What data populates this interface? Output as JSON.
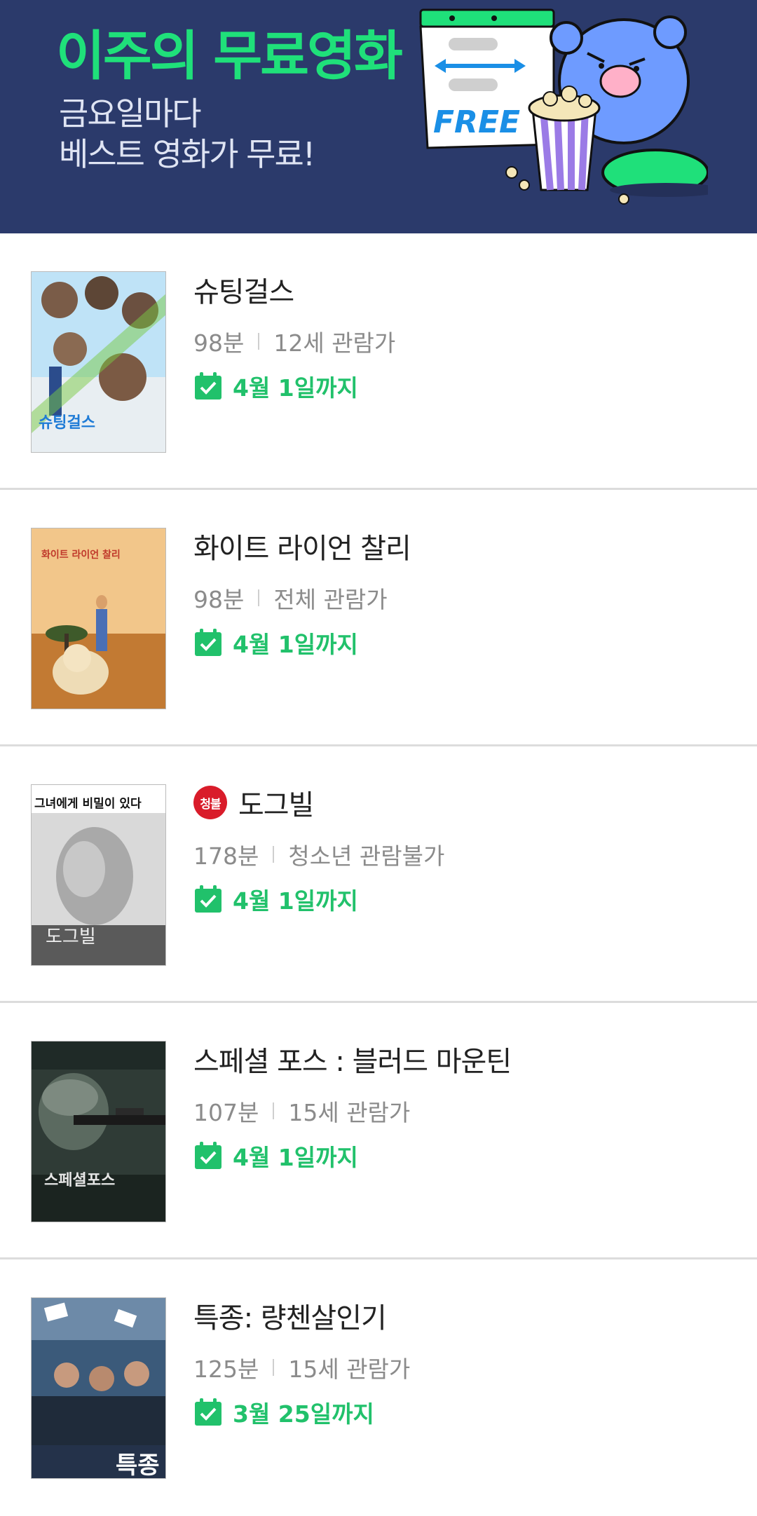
{
  "banner": {
    "title": "이주의 무료영화",
    "subtitle_line1": "금요일마다",
    "subtitle_line2": "베스트 영화가 무료!",
    "free_label": "FREE"
  },
  "colors": {
    "banner_bg": "#2b3a6b",
    "accent_green": "#21c16b",
    "badge_red": "#d91c2a"
  },
  "movies": [
    {
      "title": "슈팅걸스",
      "runtime": "98분",
      "age_rating": "12세 관람가",
      "free_until": "4월 1일까지",
      "poster_caption": "슈팅걸스",
      "badge": ""
    },
    {
      "title": "화이트 라이언 찰리",
      "runtime": "98분",
      "age_rating": "전체 관람가",
      "free_until": "4월 1일까지",
      "poster_caption": "화이트 라이언 찰리",
      "badge": ""
    },
    {
      "title": "도그빌",
      "runtime": "178분",
      "age_rating": "청소년 관람불가",
      "free_until": "4월 1일까지",
      "poster_caption": "도그빌",
      "poster_top_caption": "그녀에게 비밀이 있다",
      "badge": "청불"
    },
    {
      "title": "스페셜 포스 : 블러드 마운틴",
      "runtime": "107분",
      "age_rating": "15세 관람가",
      "free_until": "4월 1일까지",
      "poster_caption": "스페셜포스",
      "badge": ""
    },
    {
      "title": "특종: 량첸살인기",
      "runtime": "125분",
      "age_rating": "15세 관람가",
      "free_until": "3월 25일까지",
      "poster_caption": "특종",
      "badge": ""
    }
  ]
}
